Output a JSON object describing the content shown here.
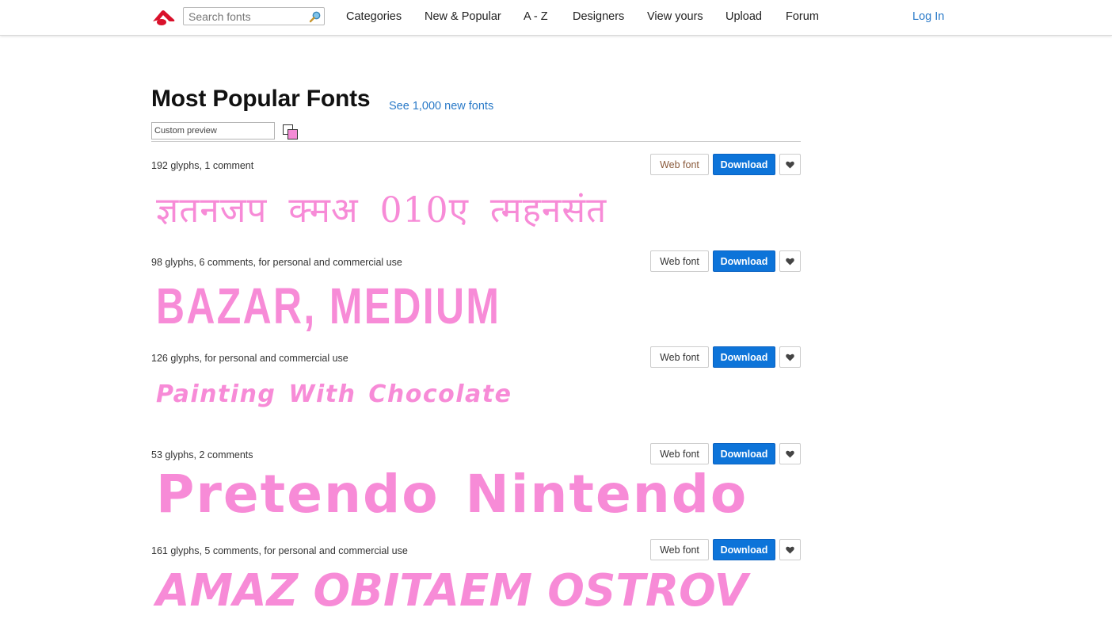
{
  "header": {
    "search_placeholder": "Search fonts",
    "nav": [
      "Categories",
      "New & Popular",
      "A - Z",
      "Designers",
      "View yours",
      "Upload",
      "Forum"
    ],
    "login": "Log In"
  },
  "page": {
    "title": "Most Popular Fonts",
    "new_fonts_link": "See 1,000 new fonts",
    "preview_placeholder": "Custom preview",
    "preview_color": "#f78bd7"
  },
  "colors": {
    "accent_link": "#2a7ac8",
    "download_button": "#0d74d9",
    "sample_text": "#f78bd7"
  },
  "fonts": [
    {
      "meta": "192 glyphs, 1 comment",
      "web_font": "Web font",
      "download": "Download",
      "sample": "ज्ञतनजप क्मअ 010ए त्महनसंत"
    },
    {
      "meta": "98 glyphs, 6 comments, for personal and commercial use",
      "web_font": "Web font",
      "download": "Download",
      "sample": "BAZAR, MEDIUM"
    },
    {
      "meta": "126 glyphs, for personal and commercial use",
      "web_font": "Web font",
      "download": "Download",
      "sample": "Painting With Chocolate"
    },
    {
      "meta": "53 glyphs, 2 comments",
      "web_font": "Web font",
      "download": "Download",
      "sample": "Pretendo Nintendo"
    },
    {
      "meta": "161 glyphs, 5 comments, for personal and commercial use",
      "web_font": "Web font",
      "download": "Download",
      "sample": "AMAZ OBITAEM OSTROV"
    }
  ],
  "icons": {
    "logo": "brand-logo-icon",
    "search": "search-magnifier-icon",
    "favorite": "heart-icon"
  }
}
